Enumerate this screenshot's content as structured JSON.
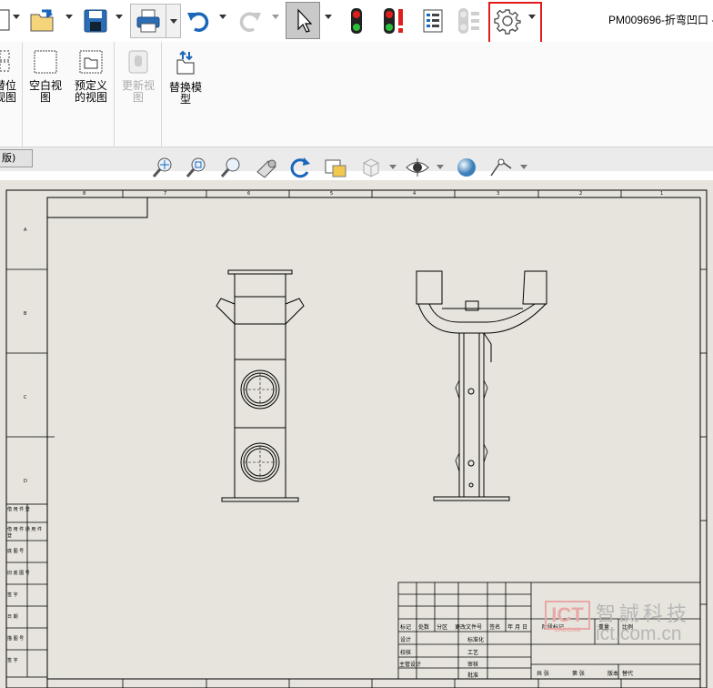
{
  "window": {
    "title": "PM009696-折弯凹口 -"
  },
  "quick_access": {
    "tools": [
      {
        "name": "new-doc-icon"
      },
      {
        "name": "open-icon"
      },
      {
        "name": "save-icon"
      },
      {
        "name": "print-icon"
      },
      {
        "name": "undo-icon"
      },
      {
        "name": "redo-icon"
      },
      {
        "name": "select-cursor-icon"
      },
      {
        "name": "rebuild-icon"
      },
      {
        "name": "rebuild-all-icon"
      },
      {
        "name": "file-properties-icon"
      },
      {
        "name": "file-explorer-icon"
      },
      {
        "name": "options-gear-icon"
      }
    ],
    "accent": "#e31b1b"
  },
  "ribbon": {
    "items": [
      {
        "label": "替位\n视图",
        "enabled": true
      },
      {
        "label": "空白视\n图",
        "enabled": true
      },
      {
        "label": "预定义\n的视图",
        "enabled": true
      },
      {
        "label": "更新视\n图",
        "enabled": false
      },
      {
        "label": "替换模\n型",
        "enabled": true
      }
    ]
  },
  "tabs": {
    "active_tab": "版)"
  },
  "view_toolbar": {
    "tools": [
      "zoom-to-fit-icon",
      "zoom-to-area-icon",
      "zoom-in-out-icon",
      "previous-view-icon",
      "rotate-view-icon",
      "section-view-icon",
      "display-style-icon",
      "hide-show-icon",
      "appearance-icon",
      "scene-icon"
    ]
  },
  "sheet": {
    "col_markers": [
      "8",
      "7",
      "6",
      "5",
      "4",
      "3",
      "2",
      "1"
    ],
    "row_markers": [
      "A",
      "B",
      "C",
      "D"
    ],
    "left_table": [
      "借 用 件 登",
      "借 用 件 通 用 件 登",
      "底 图 号",
      "旧 底 图 号",
      "签 字",
      "日 期",
      "描 图 号",
      "签 字"
    ],
    "title_block": {
      "row1": [
        "标记",
        "处数",
        "分区",
        "更改文件号",
        "签名",
        "年 月 日"
      ],
      "row2": [
        "设计",
        "标准化"
      ],
      "row3": [
        "校核",
        "工艺"
      ],
      "row4": [
        "主管设计",
        "审核"
      ],
      "row5": [
        "批准"
      ],
      "labels_right": [
        "阶段标记",
        "重量",
        "比例"
      ],
      "footer": [
        "共 张",
        "第 张",
        "版本",
        "替代"
      ]
    }
  },
  "watermark": {
    "logo": "ICT",
    "logo_sub": "CAD/CAM",
    "cn": "智誠科技",
    "url": "ict.com.cn"
  }
}
